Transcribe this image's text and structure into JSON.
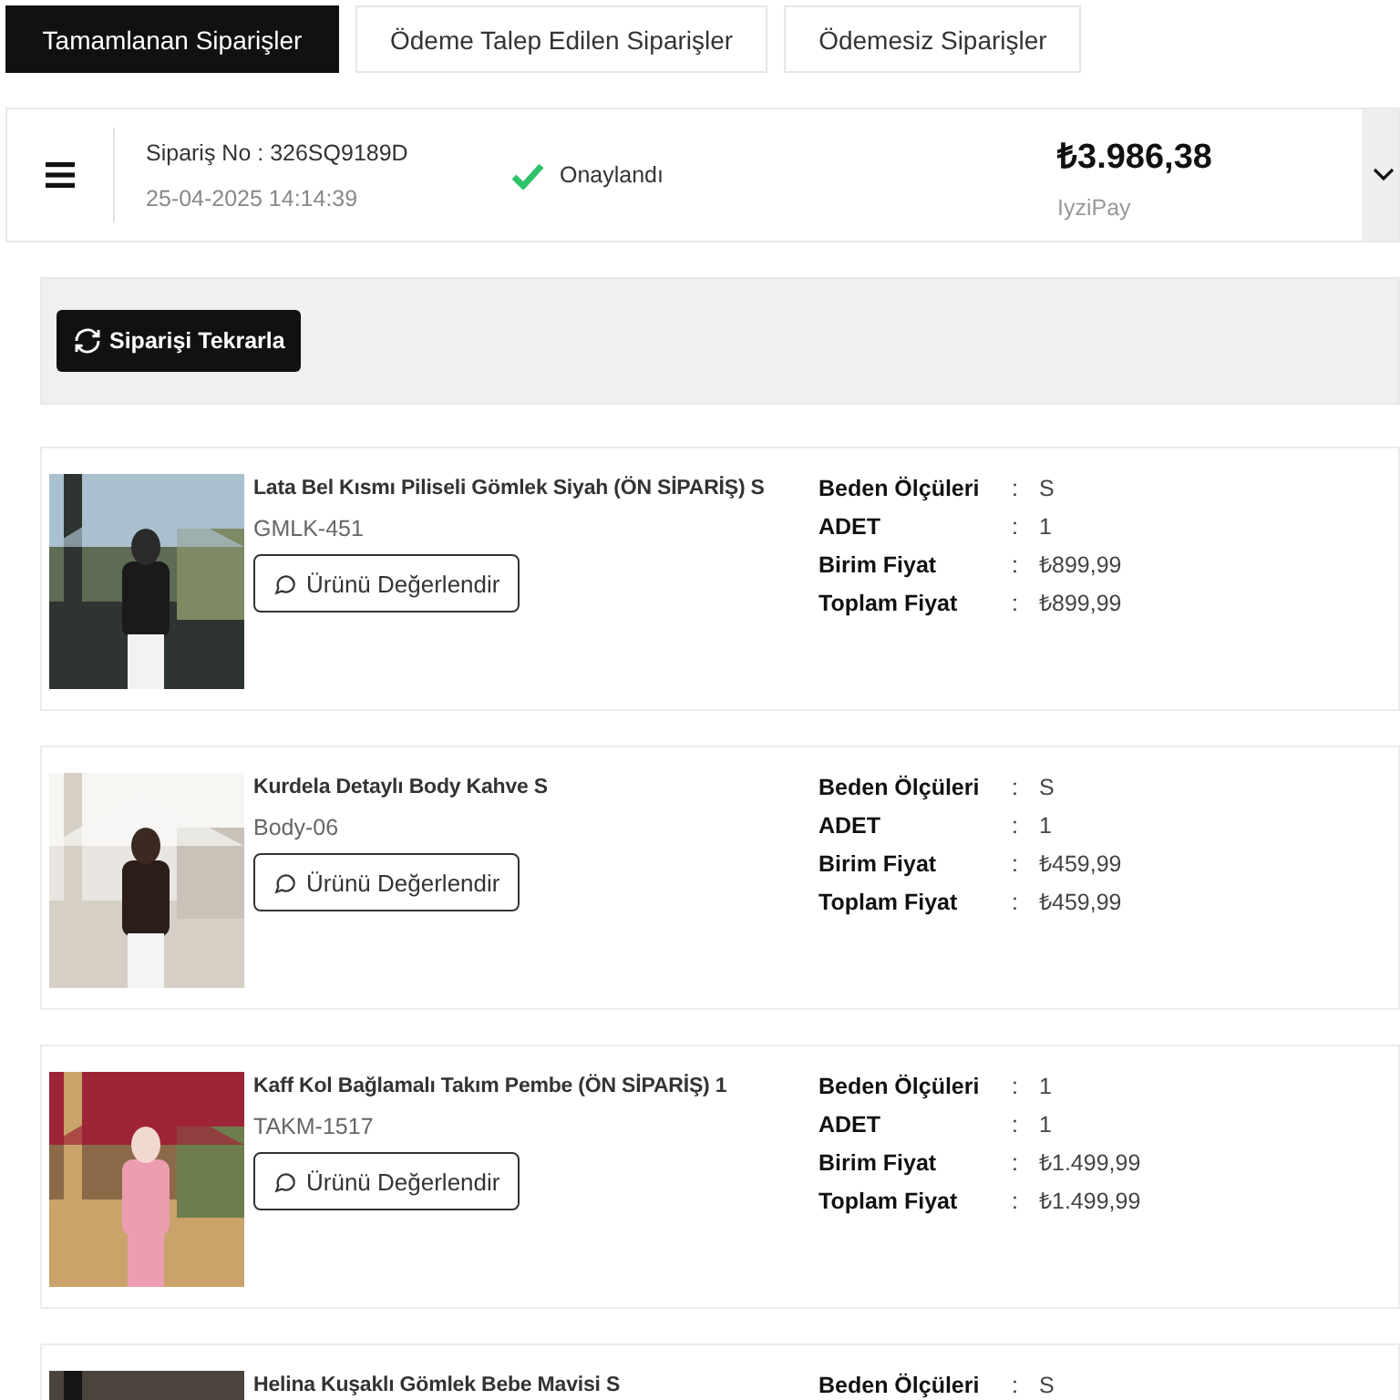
{
  "tabs": [
    {
      "label": "Tamamlanan Siparişler",
      "selected": true
    },
    {
      "label": "Ödeme Talep Edilen Siparişler",
      "selected": false
    },
    {
      "label": "Ödemesiz Siparişler",
      "selected": false
    }
  ],
  "order": {
    "number": "Sipariş No : 326SQ9189D",
    "date": "25-04-2025 14:14:39",
    "status": "Onaylandı",
    "total": "₺3.986,38",
    "payment": "IyziPay",
    "expanded": false
  },
  "reorder_button": "Siparişi Tekrarla",
  "products": [
    {
      "title": "Lata Bel Kısmı Piliseli Gömlek Siyah (ÖN SİPARİŞ) S",
      "code": "GMLK-451",
      "review_button": "Ürünü Değerlendir",
      "details": [
        {
          "label": "Beden Ölçüleri",
          "separator": ":",
          "value": "S"
        },
        {
          "label": "ADET",
          "separator": ":",
          "value": "1"
        },
        {
          "label": "Birim Fiyat",
          "separator": ":",
          "value": "₺899,99"
        },
        {
          "label": "Toplam Fiyat",
          "separator": ":",
          "value": "₺899,99"
        }
      ]
    },
    {
      "title": "Kurdela Detaylı Body Kahve S",
      "code": "Body-06",
      "review_button": "Ürünü Değerlendir",
      "details": [
        {
          "label": "Beden Ölçüleri",
          "separator": ":",
          "value": "S"
        },
        {
          "label": "ADET",
          "separator": ":",
          "value": "1"
        },
        {
          "label": "Birim Fiyat",
          "separator": ":",
          "value": "₺459,99"
        },
        {
          "label": "Toplam Fiyat",
          "separator": ":",
          "value": "₺459,99"
        }
      ]
    },
    {
      "title": "Kaff Kol Bağlamalı Takım Pembe (ÖN SİPARİŞ) 1",
      "code": "TAKM-1517",
      "review_button": "Ürünü Değerlendir",
      "details": [
        {
          "label": "Beden Ölçüleri",
          "separator": ":",
          "value": "1"
        },
        {
          "label": "ADET",
          "separator": ":",
          "value": "1"
        },
        {
          "label": "Birim Fiyat",
          "separator": ":",
          "value": "₺1.499,99"
        },
        {
          "label": "Toplam Fiyat",
          "separator": ":",
          "value": "₺1.499,99"
        }
      ]
    },
    {
      "title": "Helina Kuşaklı Gömlek Bebe Mavisi S",
      "details": [
        {
          "label": "Beden Ölçüleri",
          "separator": ":",
          "value": "S"
        }
      ]
    }
  ]
}
